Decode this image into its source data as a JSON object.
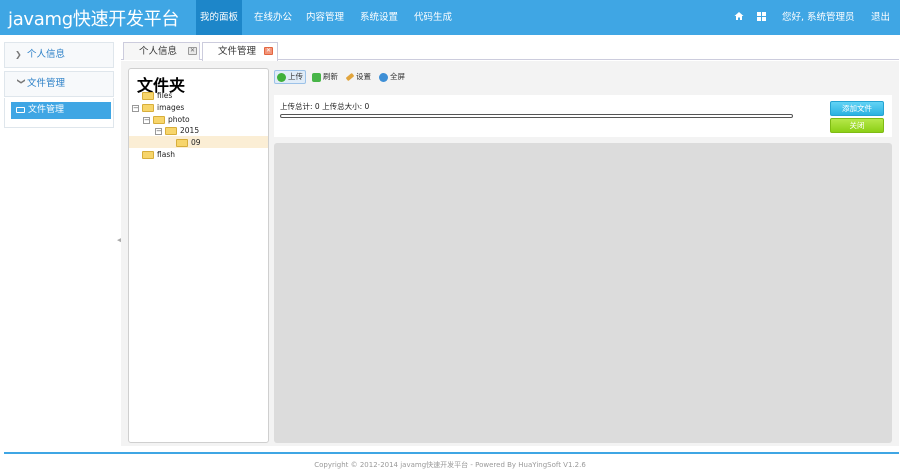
{
  "app": {
    "title": "javamg快速开发平台"
  },
  "topnav": {
    "items": [
      {
        "label": "我的面板",
        "active": true
      },
      {
        "label": "在线办公",
        "active": false
      },
      {
        "label": "内容管理",
        "active": false
      },
      {
        "label": "系统设置",
        "active": false
      },
      {
        "label": "代码生成",
        "active": false
      }
    ],
    "greeting": "您好, 系统管理员",
    "logout": "退出",
    "icons": [
      "home-icon",
      "grid-icon"
    ]
  },
  "sidebar": {
    "sections": [
      {
        "label": "个人信息",
        "expanded": false
      },
      {
        "label": "文件管理",
        "expanded": true
      }
    ],
    "active_item": "文件管理"
  },
  "tabs": [
    {
      "label": "个人信息",
      "active": false
    },
    {
      "label": "文件管理",
      "active": true
    }
  ],
  "tree": {
    "title": "文件夹",
    "nodes": [
      {
        "label": "files"
      },
      {
        "label": "images"
      },
      {
        "label": "photo"
      },
      {
        "label": "2015"
      },
      {
        "label": "09",
        "selected": true
      },
      {
        "label": "flash"
      }
    ]
  },
  "toolbar": {
    "upload": "上传",
    "refresh": "刷新",
    "settings": "设置",
    "fullscreen": "全屏"
  },
  "upload": {
    "stats": "上传总计: 0 上传总大小: 0",
    "progress": 0,
    "add_button": "添加文件",
    "close_button": "关闭"
  },
  "footer": "Copyright © 2012-2014 javamg快速开发平台 - Powered By HuaYingSoft V1.2.6",
  "colors": {
    "accent": "#3fa6e4",
    "accent_dark": "#1d86c9",
    "add_btn": "#2bb2e2",
    "close_btn": "#8ccf16"
  }
}
